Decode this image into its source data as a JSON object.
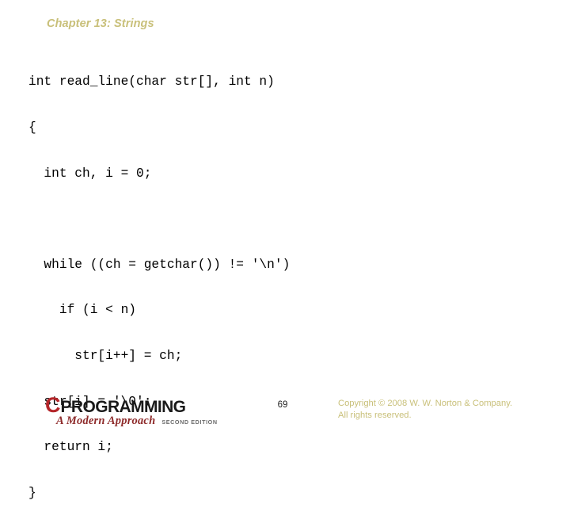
{
  "slide": {
    "title": "Chapter 13: Strings",
    "title_color": "#c9c07a",
    "background_color": "#ffffff"
  },
  "code": {
    "language": "c",
    "lines": [
      "int read_line(char str[], int n)",
      "{",
      "  int ch, i = 0;",
      "",
      "  while ((ch = getchar()) != '\\n')",
      "    if (i < n)",
      "      str[i++] = ch;",
      "  str[i] = '\\0';",
      "  return i;",
      "}"
    ]
  },
  "footer": {
    "logo": {
      "letter": "C",
      "letter_color": "#b4262a",
      "word": "PROGRAMMING",
      "word_color": "#1a1a1a",
      "subtitle": "A Modern Approach",
      "subtitle_color": "#8e2b2b",
      "edition": "SECOND EDITION",
      "edition_color": "#6b6b6b"
    },
    "page_number": "69",
    "copyright_lines": [
      "Copyright © 2008 W. W. Norton & Company.",
      "All rights reserved."
    ],
    "copyright_color": "#c9c07a"
  }
}
